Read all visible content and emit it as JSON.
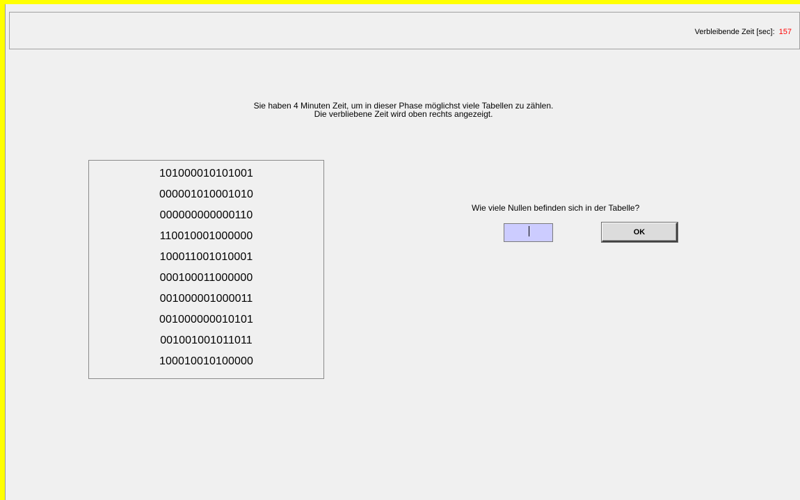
{
  "header": {
    "timer_label": "Verbleibende Zeit [sec]:",
    "timer_value": "157"
  },
  "instructions": {
    "line1": "Sie haben 4 Minuten Zeit, um in dieser Phase möglichst viele Tabellen zu zählen.",
    "line2": "Die verbliebene Zeit wird oben rechts angezeigt."
  },
  "table": {
    "rows": [
      "101000010101001",
      "000001010001010",
      "000000000000110",
      "110010001000000",
      "100011001010001",
      "000100011000000",
      "001000001000011",
      "001000000010101",
      "001001001011011",
      "100010010100000"
    ]
  },
  "answer": {
    "question": "Wie viele Nullen befinden sich in der Tabelle?",
    "input_value": "",
    "ok_label": "OK"
  },
  "colors": {
    "frame": "#ffff00",
    "timer_value": "#ff0000",
    "input_background": "#ccccff",
    "background": "#f0f0f0"
  }
}
